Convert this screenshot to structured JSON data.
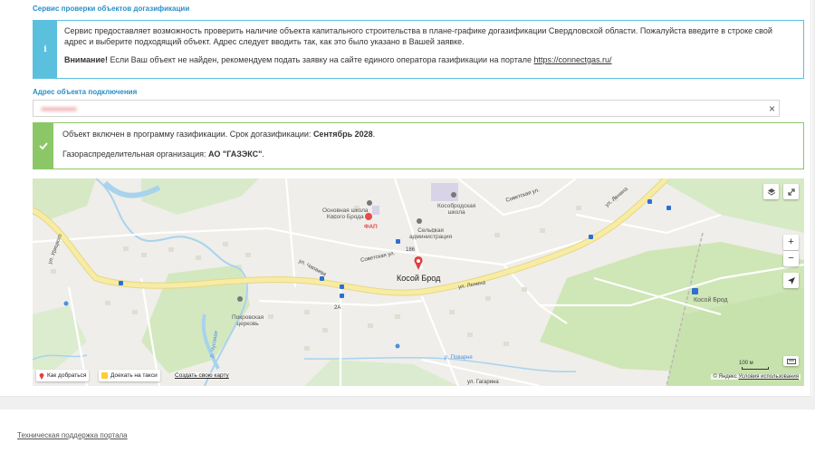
{
  "section_title": "Сервис проверки объектов догазификации",
  "info": {
    "icon": "info-icon",
    "text": "Сервис предоставляет возможность проверить наличие объекта капитального строительства в плане-графике догазификации Свердловской области. Пожалуйста введите в строке свой адрес и выберите подходящий объект. Адрес следует вводить так, как это было указано в Вашей заявке.",
    "warning_bold": "Внимание!",
    "warning_text": " Если Ваш объект не найден, рекомендуем подать заявку на сайте единого оператора газификации на портале ",
    "link": "https://connectgas.ru/"
  },
  "address": {
    "label": "Адрес объекта подключения",
    "clear": "×"
  },
  "result": {
    "icon": "check-icon",
    "line1_text": "Объект включен в программу газификации. Срок догазификации: ",
    "line1_bold": "Сентябрь 2028",
    "line1_end": ".",
    "line2_text": "Газораспределительная организация: ",
    "line2_bold": "АО \"ГАЗЭКС\"",
    "line2_end": "."
  },
  "map": {
    "labels": {
      "village": "Косой Брод",
      "station": "Косой Брод",
      "school": "Основная школа\nКосого Брода",
      "fap": "ФАП",
      "admin": "Сельская\nадминистрация",
      "school2": "Кособродская\nшкола",
      "church": "Покровская\nцерковь",
      "lenina1": "ул. Ленина",
      "lenina2": "ул. Ленина",
      "chapaeva": "ул. Чапаева",
      "sovetskaya1": "Советская ул.",
      "sovetskaya2": "Советская ул.",
      "uritskogo": "ул. Урицкого",
      "povarnya": "р. Поварня",
      "povarnya2": "р. Поварня",
      "gagarina": "ул. Гагарина",
      "chusovaya": "р. Чусовая",
      "n186": "186",
      "n2a": "2А",
      "n1": "1"
    },
    "zoom_in": "+",
    "zoom_out": "−",
    "btn_route": "Как добраться",
    "btn_taxi": "Доехать на такси",
    "create_map": "Создать свою карту",
    "scale": "100 м",
    "copyright": "© Яндекс ",
    "terms": "Условия использования"
  },
  "footer": {
    "support_link": "Техническая поддержка портала"
  },
  "colors": {
    "accent_blue": "#2a8fc8",
    "info": "#5bc0de",
    "success": "#8cc767",
    "road": "#f5e79a"
  }
}
